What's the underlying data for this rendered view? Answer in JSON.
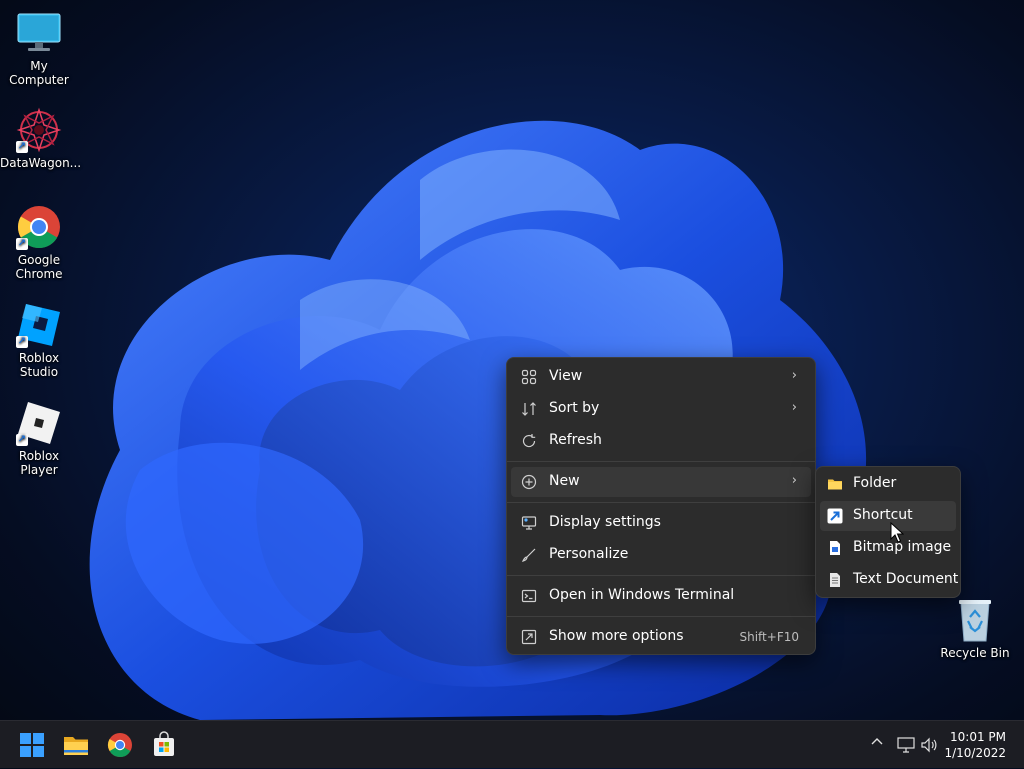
{
  "desktop": {
    "icons": [
      {
        "label": "My Computer",
        "icon": "monitor-icon"
      },
      {
        "label": "DataWagon...",
        "icon": "datawagon-icon"
      },
      {
        "label": "Google Chrome",
        "icon": "chrome-icon"
      },
      {
        "label": "Roblox Studio",
        "icon": "roblox-studio-icon"
      },
      {
        "label": "Roblox Player",
        "icon": "roblox-player-icon"
      },
      {
        "label": "Recycle Bin",
        "icon": "recycle-bin-icon"
      }
    ],
    "shortcut_glyph": "↗"
  },
  "context_menu": {
    "items": [
      {
        "label": "View",
        "icon": "view-grid-icon",
        "has_submenu": true
      },
      {
        "label": "Sort by",
        "icon": "sort-icon",
        "has_submenu": true
      },
      {
        "label": "Refresh",
        "icon": "refresh-icon"
      },
      {
        "label": "New",
        "icon": "new-plus-icon",
        "has_submenu": true
      },
      {
        "label": "Display settings",
        "icon": "display-settings-icon"
      },
      {
        "label": "Personalize",
        "icon": "brush-icon"
      },
      {
        "label": "Open in Windows Terminal",
        "icon": "terminal-icon"
      },
      {
        "label": "Show more options",
        "icon": "more-options-icon",
        "shortcut": "Shift+F10"
      }
    ],
    "chevron": "›"
  },
  "submenu_new": {
    "items": [
      {
        "label": "Folder",
        "icon": "folder-icon"
      },
      {
        "label": "Shortcut",
        "icon": "shortcut-icon"
      },
      {
        "label": "Bitmap image",
        "icon": "bitmap-icon"
      },
      {
        "label": "Text Document",
        "icon": "text-document-icon"
      }
    ]
  },
  "taskbar": {
    "apps": [
      "start-icon",
      "file-explorer-icon",
      "chrome-icon",
      "store-icon"
    ],
    "tray_chevron": "^",
    "time": "10:01 PM",
    "date": "1/10/2022"
  },
  "colors": {
    "accent": "#1f5fff",
    "menu_bg": "#2c2c2c",
    "taskbar_bg": "#1c1d23"
  }
}
